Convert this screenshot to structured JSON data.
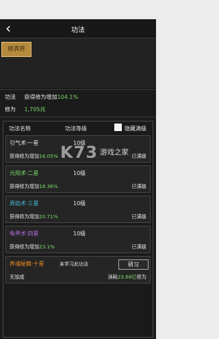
{
  "nav": {
    "back_glyph": "‹",
    "title": "功法"
  },
  "realm_button": "修真界",
  "stats": {
    "row1_label": "功法",
    "row1_text": "获得修为增加",
    "row1_value": "104.1%",
    "row2_label": "修为",
    "row2_value": "1,705兆"
  },
  "table_header": {
    "col_name": "功法名称",
    "col_level": "功法等级",
    "hide_max": "隐藏满级"
  },
  "techniques": [
    {
      "name": "引气术·一星",
      "level": "10级",
      "desc_prefix": "获得修为增加",
      "desc_value": "16.05%",
      "status": "已满级"
    },
    {
      "name": "元阳术·二星",
      "level": "10级",
      "desc_prefix": "获得修为增加",
      "desc_value": "18.36%",
      "status": "已满级"
    },
    {
      "name": "弄焰术·三星",
      "level": "10级",
      "desc_prefix": "获得修为增加",
      "desc_value": "20.71%",
      "status": "已满级"
    },
    {
      "name": "龟甲术·四星",
      "level": "10级",
      "desc_prefix": "获得修为增加",
      "desc_value": "23.1%",
      "status": "已满级"
    },
    {
      "name": "养魂秘籍·十星",
      "level": "未学习此功法",
      "learn_label": "研习",
      "desc_prefix": "无加成",
      "cost_prefix": "消耗",
      "cost_value": "23.68亿",
      "cost_suffix": "修为"
    }
  ],
  "watermark": {
    "logo": "K73",
    "site": "游戏之家"
  },
  "colors": {
    "gold": "#b58a3c",
    "green": "#7bdc6a",
    "orange": "#e98822",
    "blue": "#49c2e6",
    "purple": "#b36fe3"
  }
}
